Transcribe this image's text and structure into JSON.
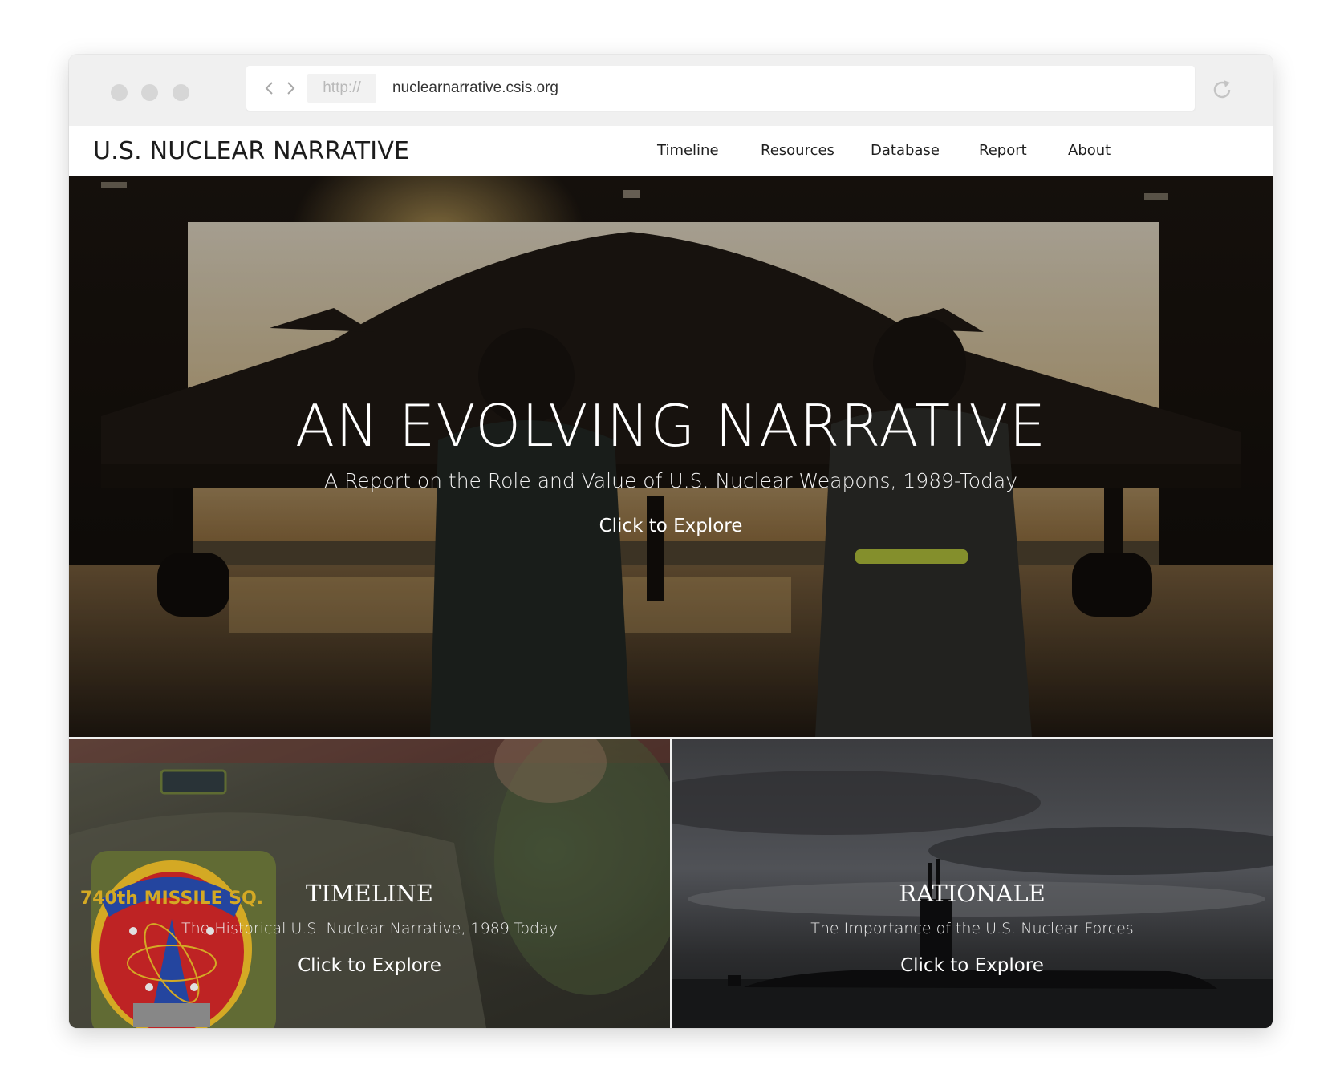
{
  "browser": {
    "protocol": "http://",
    "url": "nuclearnarrative.csis.org"
  },
  "site": {
    "logo": "U.S. NUCLEAR NARRATIVE",
    "nav": [
      "Timeline",
      "Resources",
      "Database",
      "Report",
      "About"
    ]
  },
  "hero": {
    "title": "AN EVOLVING NARRATIVE",
    "subtitle": "A Report on the Role and Value of U.S. Nuclear Weapons, 1989-Today",
    "cta": "Click to Explore"
  },
  "panels": [
    {
      "title": "TIMELINE",
      "subtitle": "The Historical U.S. Nuclear Narrative, 1989-Today",
      "cta": "Click to Explore",
      "patch_text": "740th MISSILE SQ."
    },
    {
      "title": "RATIONALE",
      "subtitle": "The Importance of the U.S. Nuclear Forces",
      "cta": "Click to Explore"
    }
  ]
}
